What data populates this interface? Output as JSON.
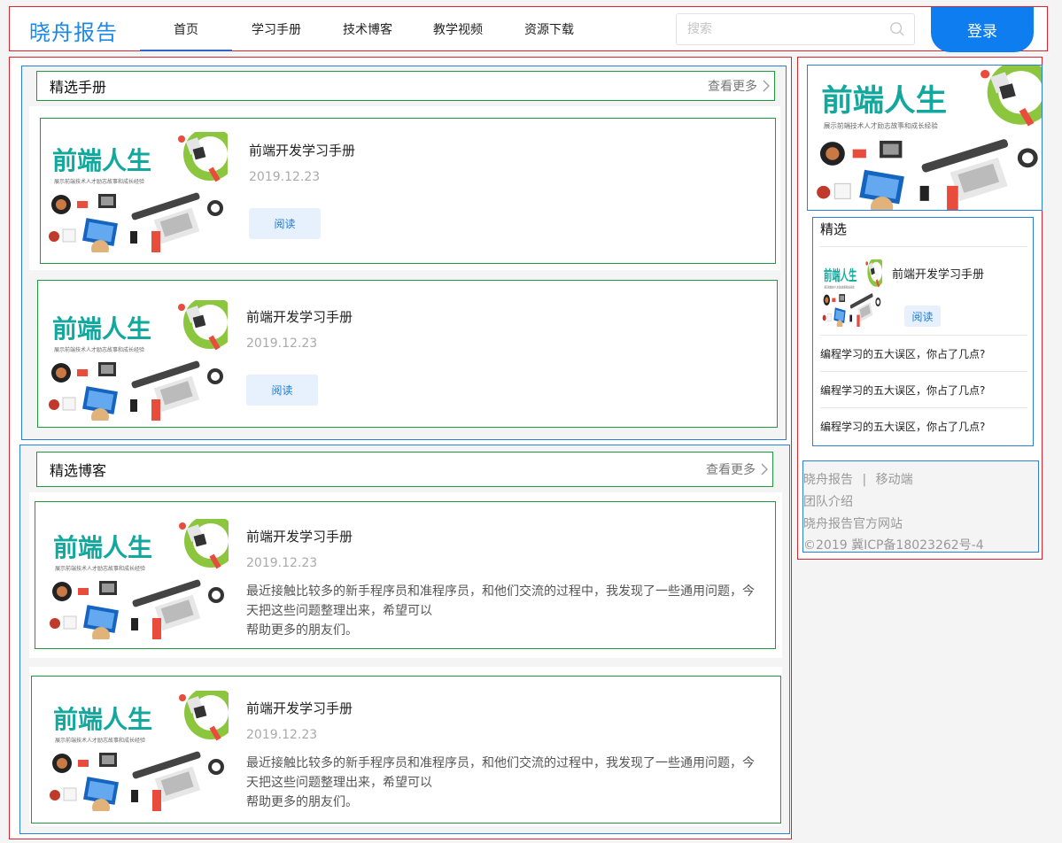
{
  "header": {
    "brand": "晓舟报告",
    "nav": [
      "首页",
      "学习手册",
      "技术博客",
      "教学视频",
      "资源下载"
    ],
    "search_placeholder": "搜索",
    "login_label": "登录"
  },
  "thumbnail": {
    "title": "前端人生",
    "subtitle": "展示前端技术人才励志故事和成长经验"
  },
  "manuals": {
    "title": "精选手册",
    "more": "查看更多",
    "items": [
      {
        "title": "前端开发学习手册",
        "date": "2019.12.23",
        "button": "阅读"
      },
      {
        "title": "前端开发学习手册",
        "date": "2019.12.23",
        "button": "阅读"
      }
    ]
  },
  "blogs": {
    "title": "精选博客",
    "more": "查看更多",
    "items": [
      {
        "title": "前端开发学习手册",
        "date": "2019.12.23",
        "desc_line1": "最近接触比较多的新手程序员和准程序员，和他们交流的过程中，我发现了一些通用问题，今",
        "desc_line2": "天把这些问题整理出来，希望可以",
        "desc_line3": "帮助更多的朋友们。"
      },
      {
        "title": "前端开发学习手册",
        "date": "2019.12.23",
        "desc_line1": "最近接触比较多的新手程序员和准程序员，和他们交流的过程中，我发现了一些通用问题，今",
        "desc_line2": "天把这些问题整理出来，希望可以",
        "desc_line3": "帮助更多的朋友们。"
      }
    ]
  },
  "sidebar": {
    "featured_title": "精选",
    "featured_item": {
      "title": "前端开发学习手册",
      "button": "阅读"
    },
    "links": [
      "编程学习的五大误区，你占了几点?",
      "编程学习的五大误区，你占了几点?",
      "编程学习的五大误区，你占了几点?"
    ],
    "footer": {
      "brand": "晓舟报告",
      "sep": "|",
      "mobile": "移动端",
      "team": "团队介绍",
      "site": "晓舟报告官方网站",
      "icp": "©2019 冀ICP备18023262号-4"
    }
  },
  "colors": {
    "brand": "#1e88e5",
    "login_bg": "#0e7df0",
    "thumb_title": "#13a89e",
    "button_bg": "#e6f1fd"
  }
}
